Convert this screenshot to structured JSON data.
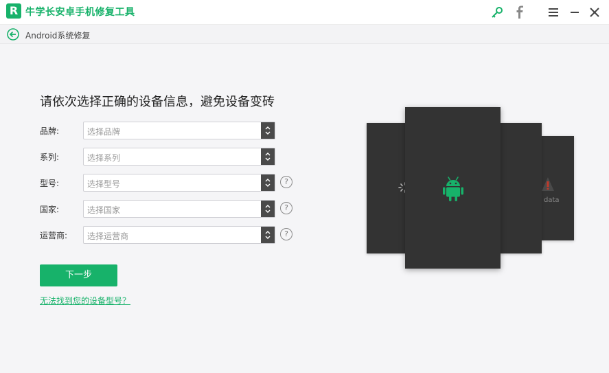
{
  "app": {
    "title": "牛学长安卓手机修复工具",
    "logo_letter": "R",
    "accent_color": "#17b26a"
  },
  "titlebar": {
    "icons": [
      "key-icon",
      "facebook-icon",
      "menu-icon",
      "minimize-icon",
      "close-icon"
    ]
  },
  "breadcrumb": {
    "label": "Android系统修复"
  },
  "main": {
    "heading": "请依次选择正确的设备信息，避免设备变砖",
    "fields": [
      {
        "label": "品牌:",
        "placeholder": "选择品牌",
        "has_help": false
      },
      {
        "label": "系列:",
        "placeholder": "选择系列",
        "has_help": false
      },
      {
        "label": "型号:",
        "placeholder": "选择型号",
        "has_help": true
      },
      {
        "label": "国家:",
        "placeholder": "选择国家",
        "has_help": true
      },
      {
        "label": "运营商:",
        "placeholder": "选择运营商",
        "has_help": true
      }
    ],
    "help_symbol": "?",
    "next_button": "下一步",
    "help_link": "无法找到您的设备型号？"
  },
  "illustration": {
    "data_label": "data",
    "icons": [
      "android-icon",
      "loading-icon",
      "warning-icon"
    ]
  }
}
